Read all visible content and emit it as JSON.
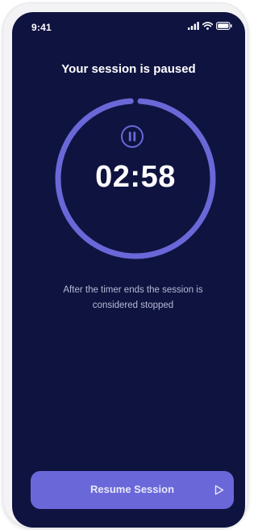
{
  "status_bar": {
    "time": "9:41",
    "icons": [
      "signal-icon",
      "wifi-icon",
      "battery-icon"
    ]
  },
  "session": {
    "title": "Your session is paused",
    "timer": "02:58",
    "progress_fraction": 0.98,
    "message": "After the timer ends the session is considered stopped",
    "state_icon": "pause-icon"
  },
  "actions": {
    "resume_label": "Resume Session",
    "resume_icon": "play-icon"
  },
  "colors": {
    "background": "#0f1340",
    "accent": "#6a68d8",
    "text": "#ffffff",
    "muted_text": "#b8bad6"
  }
}
